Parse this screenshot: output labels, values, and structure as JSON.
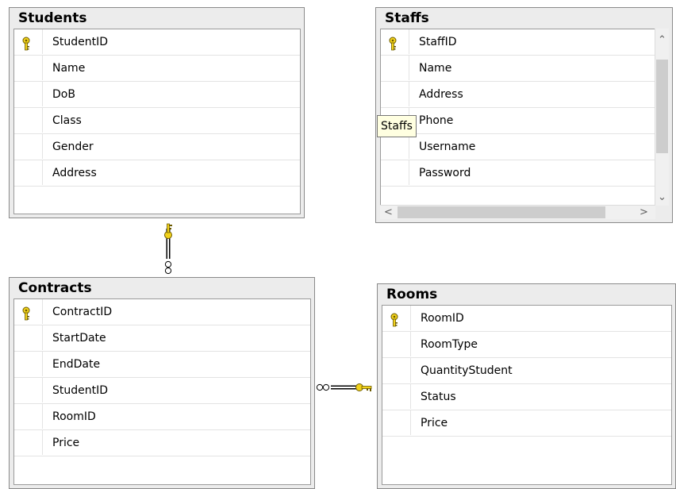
{
  "tables": {
    "students": {
      "title": "Students",
      "columns": [
        {
          "name": "StudentID",
          "pk": true
        },
        {
          "name": "Name",
          "pk": false
        },
        {
          "name": "DoB",
          "pk": false
        },
        {
          "name": "Class",
          "pk": false
        },
        {
          "name": "Gender",
          "pk": false
        },
        {
          "name": "Address",
          "pk": false
        }
      ]
    },
    "staffs": {
      "title": "Staffs",
      "columns": [
        {
          "name": "StaffID",
          "pk": true
        },
        {
          "name": "Name",
          "pk": false
        },
        {
          "name": "Address",
          "pk": false
        },
        {
          "name": "Phone",
          "pk": false
        },
        {
          "name": "Username",
          "pk": false
        },
        {
          "name": "Password",
          "pk": false
        }
      ]
    },
    "contracts": {
      "title": "Contracts",
      "columns": [
        {
          "name": "ContractID",
          "pk": true
        },
        {
          "name": "StartDate",
          "pk": false
        },
        {
          "name": "EndDate",
          "pk": false
        },
        {
          "name": "StudentID",
          "pk": false
        },
        {
          "name": "RoomID",
          "pk": false
        },
        {
          "name": "Price",
          "pk": false
        }
      ]
    },
    "rooms": {
      "title": "Rooms",
      "columns": [
        {
          "name": "RoomID",
          "pk": true
        },
        {
          "name": "RoomType",
          "pk": false
        },
        {
          "name": "QuantityStudent",
          "pk": false
        },
        {
          "name": "Status",
          "pk": false
        },
        {
          "name": "Price",
          "pk": false
        }
      ]
    }
  },
  "tooltip": {
    "text": "Staffs"
  },
  "icons": {
    "primary_key": "key-icon",
    "many_end": "infinity-icon",
    "one_end": "key-icon",
    "scroll_up": "chevron-up-icon",
    "scroll_down": "chevron-down-icon",
    "scroll_left": "chevron-left-icon",
    "scroll_right": "chevron-right-icon"
  },
  "colors": {
    "key": "#f2d21b",
    "key_outline": "#6b5a00",
    "tooltip_bg": "#ffffe1"
  },
  "relationships": [
    {
      "from": "Students",
      "to": "Contracts",
      "one_side": "Students",
      "many_side": "Contracts"
    },
    {
      "from": "Rooms",
      "to": "Contracts",
      "one_side": "Rooms",
      "many_side": "Contracts"
    }
  ]
}
